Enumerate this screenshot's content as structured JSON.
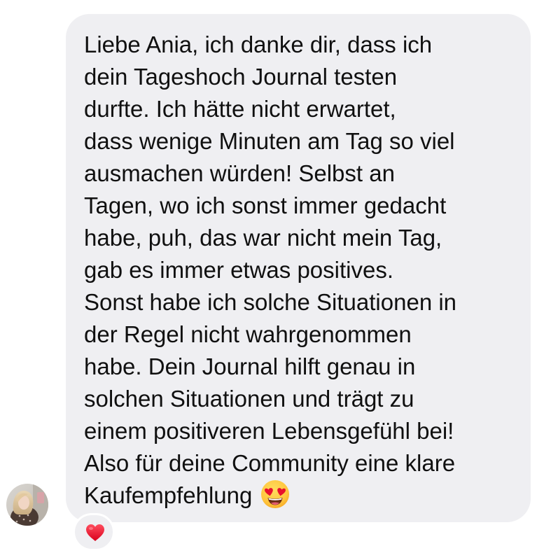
{
  "message": {
    "lines": [
      "Liebe Ania, ich danke dir, dass ich",
      "dein Tageshoch Journal testen",
      "durfte. Ich hätte nicht erwartet,",
      "dass wenige Minuten am Tag so viel",
      "ausmachen würden! Selbst an",
      "Tagen, wo ich sonst immer gedacht",
      "habe, puh, das war nicht mein Tag,",
      "gab es immer etwas positives.",
      "Sonst habe ich solche Situationen in",
      "der Regel nicht wahrgenommen",
      "habe. Dein Journal hilft genau in",
      "solchen Situationen und trägt zu",
      "einem positiveren Lebensgefühl bei!",
      "Also für deine Community eine klare",
      "Kaufempfehlung"
    ],
    "trailing_emoji": "heart-eyes-emoji"
  },
  "sender": {
    "avatar_icon": "avatar-photo"
  },
  "reaction": {
    "icon": "red-heart-icon"
  },
  "colors": {
    "bubble_background": "#efeff2",
    "text": "#101010",
    "heart": "#e8112d",
    "emoji_face": "#ffc53d"
  }
}
